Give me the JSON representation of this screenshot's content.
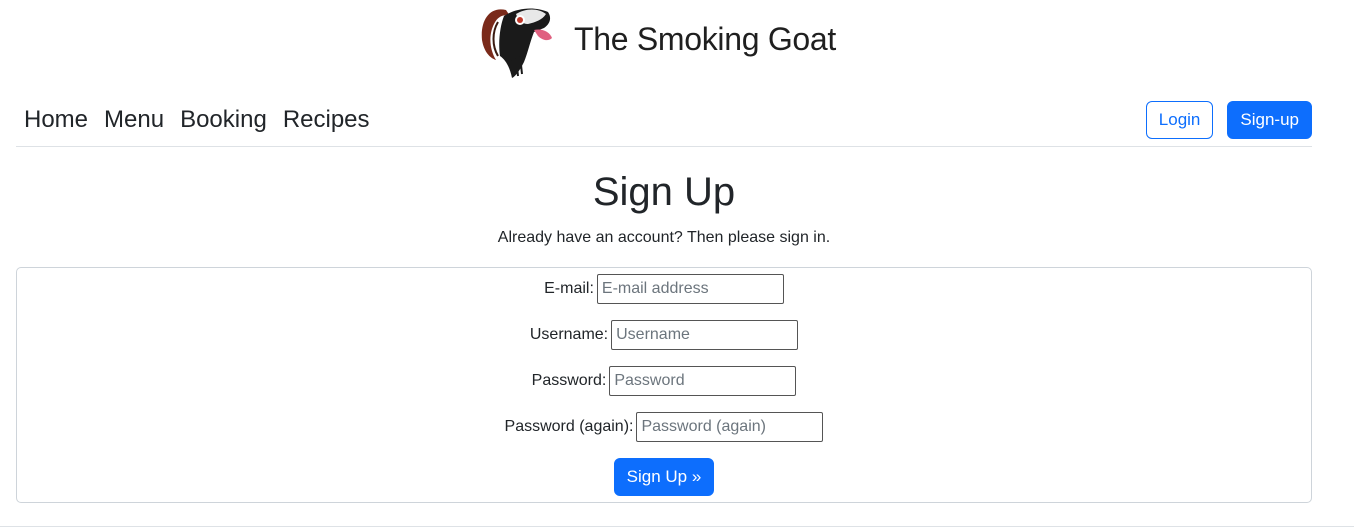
{
  "brand": {
    "name": "The Smoking Goat",
    "logo_icon": "goat-logo-icon"
  },
  "nav": {
    "links": [
      "Home",
      "Menu",
      "Booking",
      "Recipes"
    ],
    "login_label": "Login",
    "signup_label": "Sign-up"
  },
  "page": {
    "title": "Sign Up",
    "intro_text": "Already have an account? Then please ",
    "intro_link": "sign in",
    "intro_end": "."
  },
  "form": {
    "email_label": "E-mail:",
    "email_placeholder": "E-mail address",
    "username_label": "Username:",
    "username_placeholder": "Username",
    "password_label": "Password:",
    "password_placeholder": "Password",
    "password2_label": "Password (again):",
    "password2_placeholder": "Password (again)",
    "submit_label": "Sign Up »"
  },
  "colors": {
    "primary": "#0d6efd",
    "text": "#212529"
  }
}
